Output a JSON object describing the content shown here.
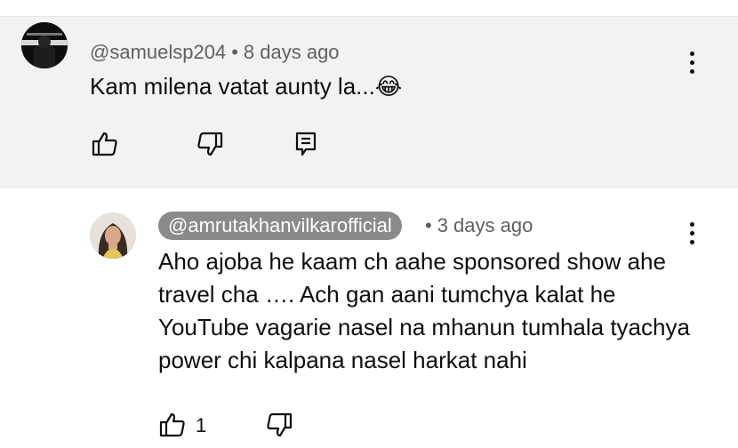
{
  "comment": {
    "handle": "@samuelsp204",
    "separator": "•",
    "time": "8 days ago",
    "text": "Kam milena vatat aunty la...",
    "emoji": "😂"
  },
  "reply": {
    "handle": "@amrutakhanvilkarofficial",
    "separator": "•",
    "time": "3 days ago",
    "text": "Aho ajoba he kaam ch aahe sponsored show ahe travel cha …. Ach gan aani tumchya kalat he YouTube vagarie nasel na mhanun tumhala tyachya power chi kalpana nasel harkat nahi",
    "like_count": "1"
  },
  "icons": {
    "like": "thumbs-up-icon",
    "dislike": "thumbs-down-icon",
    "reply": "reply-icon",
    "more": "more-vert-icon"
  },
  "colors": {
    "comment_background": "#f2f2f2",
    "handle_pill": "#8a8a8a"
  }
}
